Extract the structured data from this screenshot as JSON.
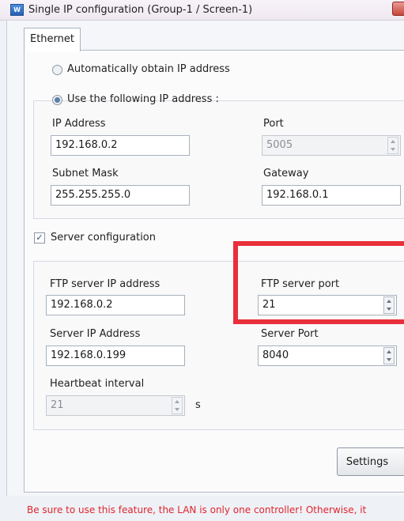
{
  "window": {
    "title": "Single IP configuration   (Group-1 / Screen-1)",
    "app_icon": "app-icon"
  },
  "tabs": [
    {
      "label": "Ethernet",
      "active": true
    }
  ],
  "ip_mode": {
    "auto_label": "Automatically obtain IP address",
    "manual_label": "Use the following IP address :",
    "selected": "manual"
  },
  "network": {
    "ip_label": "IP Address",
    "ip_value": "192.168.0.2",
    "port_label": "Port",
    "port_value": "5005",
    "subnet_label": "Subnet Mask",
    "subnet_value": "255.255.255.0",
    "gateway_label": "Gateway",
    "gateway_value": "192.168.0.1"
  },
  "server": {
    "checkbox_label": "Server configuration",
    "checked": true,
    "ftp_ip_label": "FTP server IP address",
    "ftp_ip_value": "192.168.0.2",
    "ftp_port_label": "FTP server port",
    "ftp_port_value": "21",
    "server_ip_label": "Server IP Address",
    "server_ip_value": "192.168.0.199",
    "server_port_label": "Server Port",
    "server_port_value": "8040",
    "heartbeat_label": "Heartbeat interval",
    "heartbeat_value": "21",
    "heartbeat_unit": "s"
  },
  "actions": {
    "settings_label": "Settings"
  },
  "warning": "Be sure to use this feature, the LAN is only one controller! Otherwise, it",
  "colors": {
    "highlight": "#e8303a",
    "warning": "#e0252d",
    "radio_selected": "#5a7fa8"
  }
}
